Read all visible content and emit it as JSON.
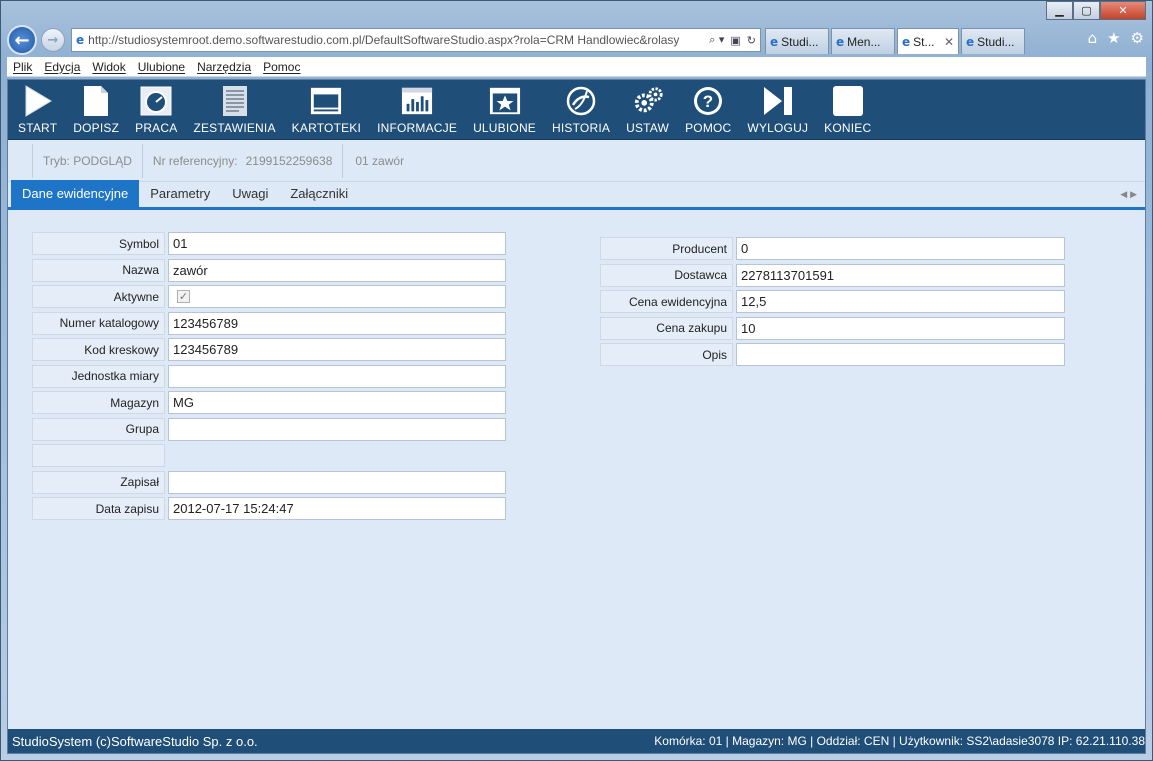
{
  "browser": {
    "url": "http://studiosystemroot.demo.softwarestudio.com.pl/DefaultSoftwareStudio.aspx?rola=CRM Handlowiec&rolasy",
    "tabs": [
      {
        "label": "Studi...",
        "active": false
      },
      {
        "label": "Men...",
        "active": false
      },
      {
        "label": "St...",
        "active": true
      },
      {
        "label": "Studi...",
        "active": false
      }
    ],
    "menu": [
      "Plik",
      "Edycja",
      "Widok",
      "Ulubione",
      "Narzędzia",
      "Pomoc"
    ]
  },
  "toolbar": [
    {
      "label": "START",
      "icon": "play-icon"
    },
    {
      "label": "DOPISZ",
      "icon": "document-icon"
    },
    {
      "label": "PRACA",
      "icon": "gauge-icon"
    },
    {
      "label": "ZESTAWIENIA",
      "icon": "report-icon"
    },
    {
      "label": "KARTOTEKI",
      "icon": "monitor-icon"
    },
    {
      "label": "INFORMACJE",
      "icon": "chart-icon"
    },
    {
      "label": "ULUBIONE",
      "icon": "star-icon"
    },
    {
      "label": "HISTORIA",
      "icon": "history-icon"
    },
    {
      "label": "USTAW",
      "icon": "gears-icon"
    },
    {
      "label": "POMOC",
      "icon": "help-icon"
    },
    {
      "label": "WYLOGUJ",
      "icon": "logout-icon"
    },
    {
      "label": "KONIEC",
      "icon": "stop-icon"
    }
  ],
  "info": {
    "mode": "Tryb: PODGLĄD",
    "ref_label": "Nr referencyjny:",
    "ref_value": "2199152259638",
    "record": "01 zawór"
  },
  "tabs": [
    "Dane ewidencyjne",
    "Parametry",
    "Uwagi",
    "Załączniki"
  ],
  "left_fields": [
    {
      "label": "Symbol",
      "value": "01"
    },
    {
      "label": "Nazwa",
      "value": "zawór"
    },
    {
      "label": "Aktywne",
      "value": "",
      "checkbox": true
    },
    {
      "label": "Numer katalogowy",
      "value": "123456789"
    },
    {
      "label": "Kod kreskowy",
      "value": "123456789"
    },
    {
      "label": "Jednostka miary",
      "value": ""
    },
    {
      "label": "Magazyn",
      "value": "MG"
    },
    {
      "label": "Grupa",
      "value": ""
    },
    {
      "label": "",
      "value": "",
      "spacer": true
    },
    {
      "label": "Zapisał",
      "value": ""
    },
    {
      "label": "Data zapisu",
      "value": "2012-07-17 15:24:47"
    }
  ],
  "right_fields": [
    {
      "label": "Producent",
      "value": "0"
    },
    {
      "label": "Dostawca",
      "value": "2278113701591"
    },
    {
      "label": "Cena ewidencyjna",
      "value": "12,5"
    },
    {
      "label": "Cena zakupu",
      "value": "10"
    },
    {
      "label": "Opis",
      "value": ""
    }
  ],
  "status": {
    "left": "StudioSystem (c)SoftwareStudio Sp. z o.o.",
    "right": "Komórka: 01 | Magazyn: MG | Oddział: CEN | Użytkownik: SS2\\adasie3078 IP: 62.21.110.38"
  }
}
